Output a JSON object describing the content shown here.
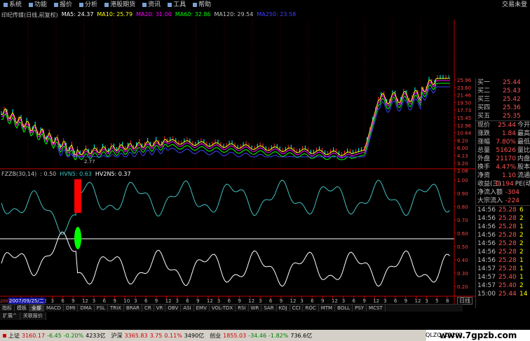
{
  "menu": {
    "items": [
      "系统",
      "功能",
      "报价",
      "分析",
      "港股期货",
      "资讯",
      "工具",
      "帮助"
    ],
    "right_label": "交易未登"
  },
  "header": {
    "title": "印纪传媒(日线,前复权)",
    "ma": [
      {
        "label": "MA5: 24.37",
        "color": "#ffffff"
      },
      {
        "label": "MA10: 25.79",
        "color": "#ffff00"
      },
      {
        "label": "MA20: 31.00",
        "color": "#ff00ff"
      },
      {
        "label": "MA60: 32.86",
        "color": "#00ff00"
      },
      {
        "label": "MA120: 29.54",
        "color": "#c0c0c0"
      },
      {
        "label": "MA250: 23.58",
        "color": "#4040ff"
      }
    ]
  },
  "oscillator": {
    "title": "FZZB(30,14)",
    "items": [
      {
        "label": ": 0.50",
        "color": "#c0c0c0"
      },
      {
        "label": "HVN5: 0.63",
        "color": "#40c0c0"
      },
      {
        "label": "HV2N5: 0.37",
        "color": "#ffffff"
      }
    ]
  },
  "price_axis": [
    "25.96",
    "23.60",
    "21.46",
    "19.50",
    "17.73",
    "15.45",
    "12.96",
    "10.64",
    "8.20",
    "6.00",
    "4.13",
    "3.20",
    "2.08"
  ],
  "osc_axis": [
    "1.00",
    "0.90",
    "0.80",
    "0.70",
    "0.60",
    "0.50",
    "0.40",
    "0.30",
    "0.20"
  ],
  "low_annotation": "2.77",
  "date_axis": {
    "start": "2007",
    "highlight": "2007/09/25/二",
    "months": [
      "7",
      "9",
      "12",
      "3",
      "6",
      "9",
      "12",
      "3",
      "6",
      "9",
      "10",
      "3",
      "6",
      "9",
      "12",
      "3",
      "6",
      "9",
      "12",
      "3",
      "6",
      "9",
      "12",
      "3",
      "6",
      "9",
      "12",
      "3",
      "6",
      "9",
      "12",
      "3",
      "6",
      "9",
      "12",
      "3",
      "6",
      "9",
      "12",
      "3",
      "5",
      "8"
    ]
  },
  "quotes": [
    {
      "label": "买一",
      "value": "25.44"
    },
    {
      "label": "买二",
      "value": "25.43"
    },
    {
      "label": "买三",
      "value": "25.42"
    },
    {
      "label": "买四",
      "value": "25.36"
    },
    {
      "label": "买五",
      "value": "25.35"
    }
  ],
  "stats": [
    {
      "label": "现价",
      "value": "25.44",
      "tail": "今开"
    },
    {
      "label": "涨跌",
      "value": "1.84",
      "tail": "最高"
    },
    {
      "label": "涨幅",
      "value": "7.80%",
      "tail": "最低"
    },
    {
      "label": "总量",
      "value": "51626",
      "tail": "量比"
    },
    {
      "label": "外盘",
      "value": "21170",
      "tail": "内盘"
    },
    {
      "label": "换手",
      "value": "4.47%",
      "tail": "股本"
    },
    {
      "label": "净资",
      "value": "1.10",
      "tail": "流通"
    },
    {
      "label": "收益(三)",
      "value": "0.194",
      "tail": "PE(动"
    },
    {
      "label": "净流入额",
      "value": "-304",
      "tail": ""
    },
    {
      "label": "大宗流入",
      "value": "-224",
      "tail": ""
    }
  ],
  "ticks": [
    {
      "time": "14:56",
      "price": "25.28",
      "vol": "6"
    },
    {
      "time": "14:56",
      "price": "25.28",
      "vol": "2"
    },
    {
      "time": "14:56",
      "price": "25.28",
      "vol": "1"
    },
    {
      "time": "14:56",
      "price": "25.28",
      "vol": "2"
    },
    {
      "time": "14:56",
      "price": "25.28",
      "vol": "2"
    },
    {
      "time": "14:56",
      "price": "25.28",
      "vol": "2"
    },
    {
      "time": "14:56",
      "price": "25.28",
      "vol": "1"
    },
    {
      "time": "14:57",
      "price": "25.28",
      "vol": "1"
    },
    {
      "time": "14:57",
      "price": "25.40",
      "vol": "1"
    },
    {
      "time": "14:57",
      "price": "25.40",
      "vol": "2"
    },
    {
      "time": "15:00",
      "price": "25.44",
      "vol": "14"
    }
  ],
  "tabs": [
    "指标",
    "模板",
    "全部",
    "MACD",
    "DMI",
    "DMA",
    "FSL",
    "TRIX",
    "BRAR",
    "CR",
    "VR",
    "OBV",
    "ASI",
    "EMV",
    "VOL-TDX",
    "RSI",
    "WR",
    "SAR",
    "KDJ",
    "CCI",
    "ROC",
    "MTM",
    "BOLL",
    "PSY",
    "MCST"
  ],
  "active_tab": "全部",
  "day_tab": "日线",
  "subtabs": [
    "扩展^",
    "关联报价"
  ],
  "status": [
    {
      "name": "上证",
      "price": "3160.17",
      "chg": "-6.45",
      "pct": "-0.20%",
      "vol": "4233亿"
    },
    {
      "name": "沪深",
      "price": "3365.83",
      "chg": "3.75",
      "pct": "0.11%",
      "vol": "3490亿"
    },
    {
      "name": "创业",
      "price": "1855.03",
      "chg": "-34.46",
      "pct": "-1.82%",
      "vol": "736.6亿"
    }
  ],
  "status_code": "QLZQ_ZB202",
  "watermark": "www.7gpzb.com",
  "colors": {
    "up": "#ff3030",
    "down": "#00ffff",
    "axis": "#c00000",
    "osc1": "#40c0c0",
    "osc2": "#ffffff"
  }
}
